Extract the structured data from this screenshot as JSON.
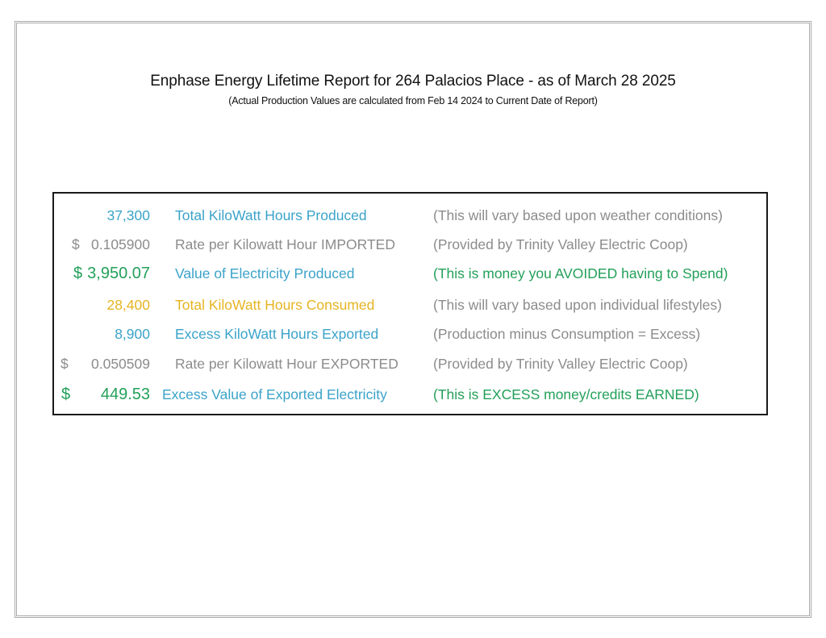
{
  "title": "Enphase Energy Lifetime Report for 264 Palacios Place - as of March 28 2025",
  "subtitle": "(Actual Production Values are calculated from Feb 14 2024 to Current Date of Report)",
  "colors": {
    "blue": "#3ba3c9",
    "gray": "#8c8c8c",
    "green": "#23a05a",
    "gold": "#e6b422",
    "border": "#1a1a1a"
  },
  "rows": [
    {
      "currency": "",
      "value": "37,300",
      "label": "Total KiloWatt Hours Produced",
      "note": "(This will vary based upon weather conditions)"
    },
    {
      "currency": "$",
      "value": "0.105900",
      "label": "Rate per Kilowatt Hour IMPORTED",
      "note": "(Provided by Trinity Valley Electric Coop)"
    },
    {
      "currency": "$",
      "value": "3,950.07",
      "label": "Value of Electricity Produced",
      "note": "(This is money you AVOIDED having to Spend)"
    },
    {
      "currency": "",
      "value": "28,400",
      "label": "Total KiloWatt Hours Consumed",
      "note": "(This will vary based upon individual lifestyles)"
    },
    {
      "currency": "",
      "value": "8,900",
      "label": "Excess KiloWatt Hours Exported",
      "note": "(Production minus Consumption = Excess)"
    },
    {
      "currency": "$",
      "value": "0.050509",
      "label": "Rate per Kilowatt Hour EXPORTED",
      "note": "(Provided by Trinity Valley Electric Coop)"
    },
    {
      "currency": "$",
      "value": "449.53",
      "label": "Excess Value of Exported Electricity",
      "note": "(This is EXCESS money/credits EARNED)"
    }
  ]
}
